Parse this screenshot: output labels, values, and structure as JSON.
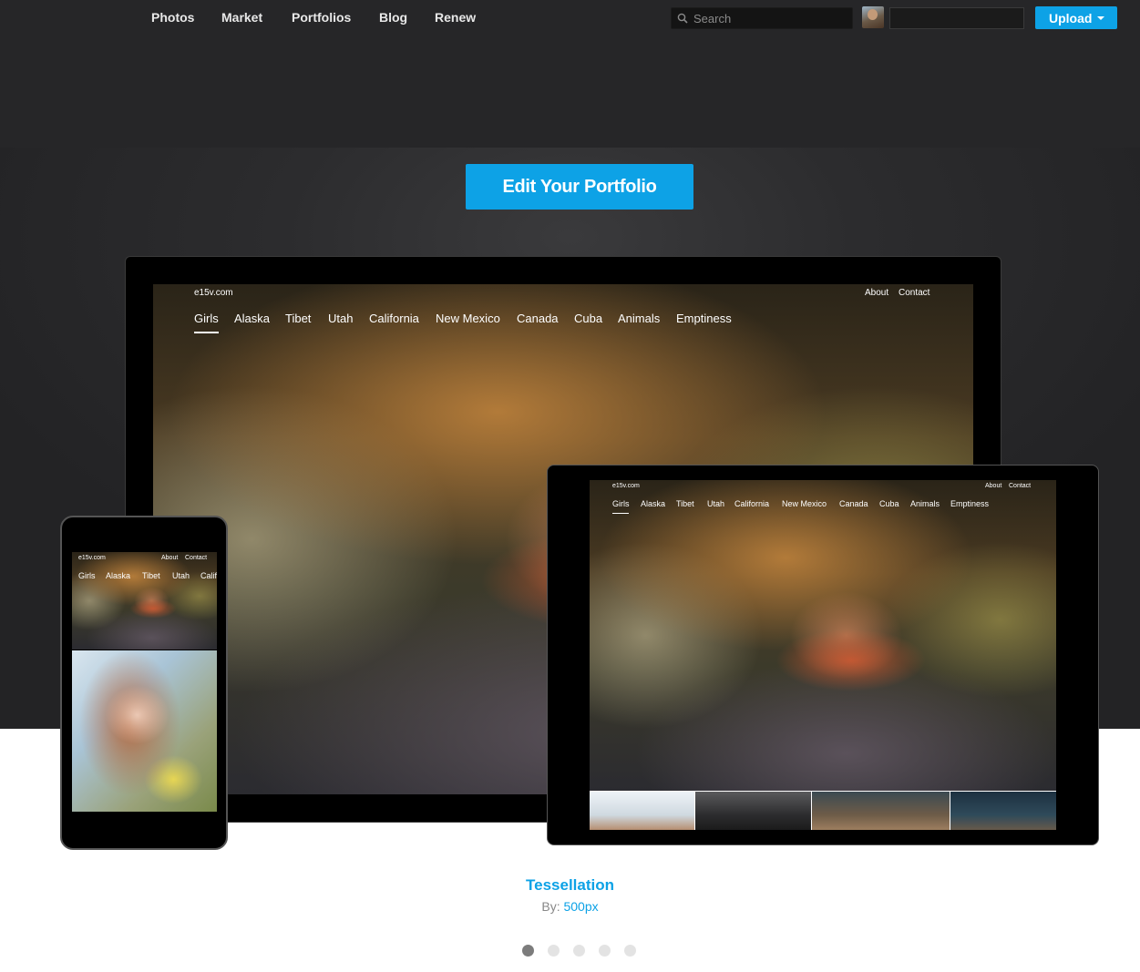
{
  "nav": {
    "links": [
      "Photos",
      "Market",
      "Portfolios",
      "Blog",
      "Renew"
    ],
    "search_placeholder": "Search",
    "upload_label": "Upload"
  },
  "hero": {
    "edit_button_label": "Edit Your Portfolio"
  },
  "portfolio_site": {
    "domain": "e15v.com",
    "about": "About",
    "contact": "Contact",
    "categories": [
      "Girls",
      "Alaska",
      "Tibet",
      "Utah",
      "California",
      "New Mexico",
      "Canada",
      "Cuba",
      "Animals",
      "Emptiness"
    ],
    "phone_categories": [
      "Girls",
      "Alaska",
      "Tibet",
      "Utah",
      "Calif"
    ]
  },
  "theme": {
    "name": "Tessellation",
    "by_label": "By:",
    "author": "500px"
  },
  "carousel": {
    "dot_count": 5,
    "active_index": 0
  },
  "colors": {
    "accent": "#0da2e6",
    "hero_background": "#2c2c2e",
    "dot_active": "#7c7c7c",
    "dot_inactive": "#e3e3e3"
  }
}
